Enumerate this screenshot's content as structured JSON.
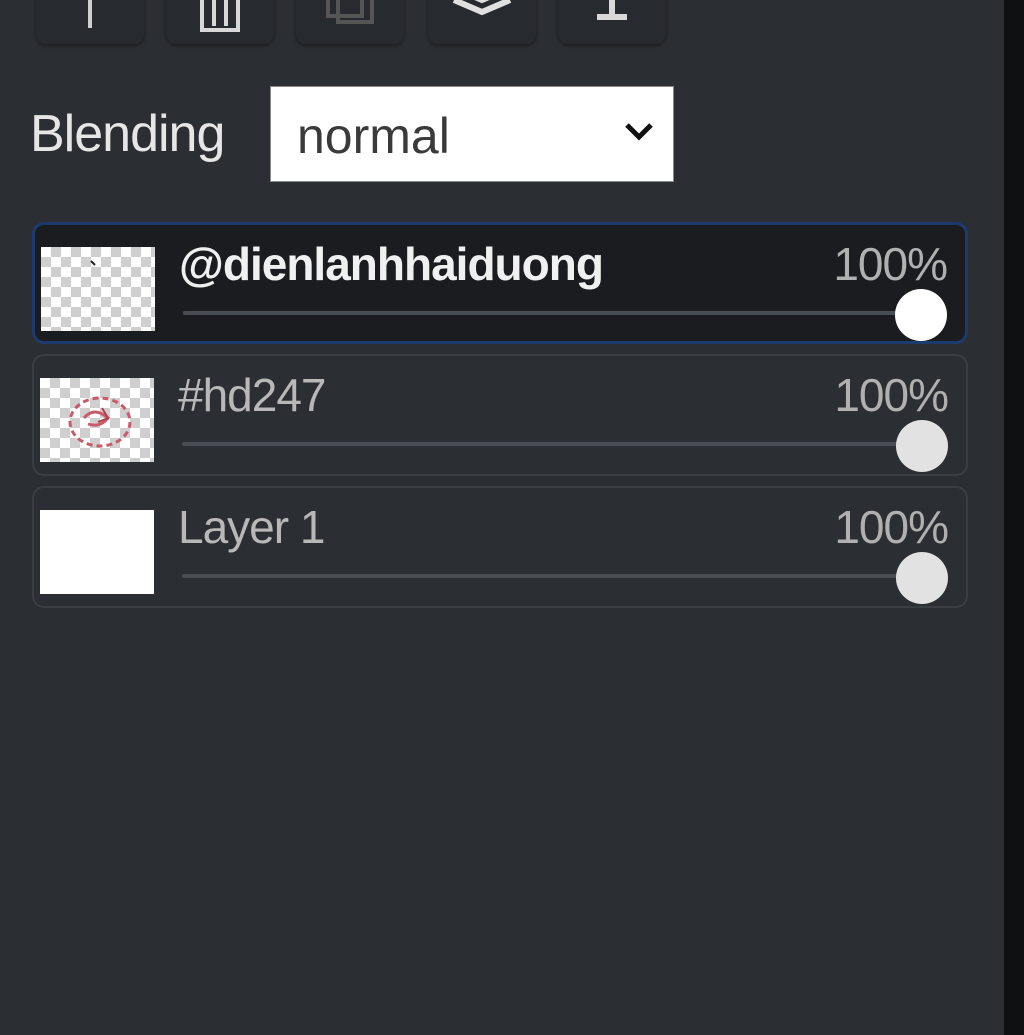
{
  "toolbar": {
    "buttons": [
      {
        "icon": "arrow-icon"
      },
      {
        "icon": "trash-icon"
      },
      {
        "icon": "duplicate-icon"
      },
      {
        "icon": "layers-icon"
      },
      {
        "icon": "merge-down-icon"
      }
    ]
  },
  "blending": {
    "label": "Blending",
    "value": "normal"
  },
  "layers": [
    {
      "name": "@dienlanhhaiduong",
      "opacity_label": "100%",
      "opacity": 1.0,
      "active": true,
      "thumbnail": "transparent"
    },
    {
      "name": "#hd247",
      "opacity_label": "100%",
      "opacity": 1.0,
      "active": false,
      "thumbnail": "transparent-with-red-sketch"
    },
    {
      "name": "Layer 1",
      "opacity_label": "100%",
      "opacity": 1.0,
      "active": false,
      "thumbnail": "white"
    }
  ],
  "colors": {
    "panel_background": "#2b2e32",
    "active_layer_border": "#1d3a6e"
  }
}
